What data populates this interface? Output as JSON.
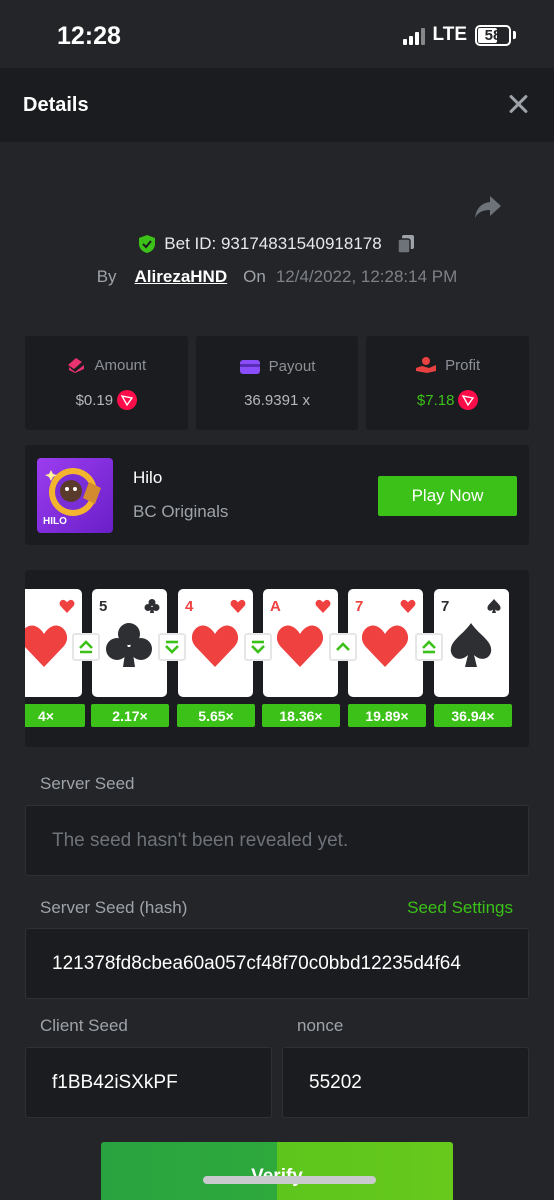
{
  "status_bar": {
    "time": "12:28",
    "network": "LTE",
    "battery": "58"
  },
  "header": {
    "title": "Details"
  },
  "bet": {
    "id_text": "Bet ID: 93174831540918178",
    "by_label": "By",
    "username": "AlirezaHND",
    "on_label": "On",
    "date": "12/4/2022, 12:28:14 PM"
  },
  "stats": {
    "amount": {
      "label": "Amount",
      "value": "$0.19"
    },
    "payout": {
      "label": "Payout",
      "value": "36.9391 x"
    },
    "profit": {
      "label": "Profit",
      "value": "$7.18"
    }
  },
  "game": {
    "name": "Hilo",
    "provider": "BC Originals",
    "thumb_label": "HILO",
    "play_label": "Play Now"
  },
  "cards": [
    {
      "rank": "",
      "suit": "heart",
      "multiplier": "4×"
    },
    {
      "rank": "5",
      "suit": "club",
      "multiplier": "2.17×"
    },
    {
      "rank": "4",
      "suit": "heart",
      "multiplier": "5.65×"
    },
    {
      "rank": "A",
      "suit": "heart",
      "multiplier": "18.36×"
    },
    {
      "rank": "7",
      "suit": "heart",
      "multiplier": "19.89×"
    },
    {
      "rank": "7",
      "suit": "spade",
      "multiplier": "36.94×"
    }
  ],
  "arrows": [
    "higher-or-equal",
    "lower-or-equal",
    "lower-or-equal",
    "higher",
    "higher-or-equal"
  ],
  "seeds": {
    "server_seed_label": "Server Seed",
    "server_seed_value": "The seed hasn't been revealed yet.",
    "server_hash_label": "Server Seed (hash)",
    "seed_settings": "Seed Settings",
    "server_hash_value": "121378fd8cbea60a057cf48f70c0bbd12235d4f64",
    "client_seed_label": "Client Seed",
    "client_seed_value": "f1BB42iSXkPF",
    "nonce_label": "nonce",
    "nonce_value": "55202"
  },
  "verify_label": "Verify",
  "colors": {
    "accent_green": "#3bc117",
    "panel": "#1a1c1f",
    "background": "#232528",
    "suit_red": "#f04141"
  }
}
